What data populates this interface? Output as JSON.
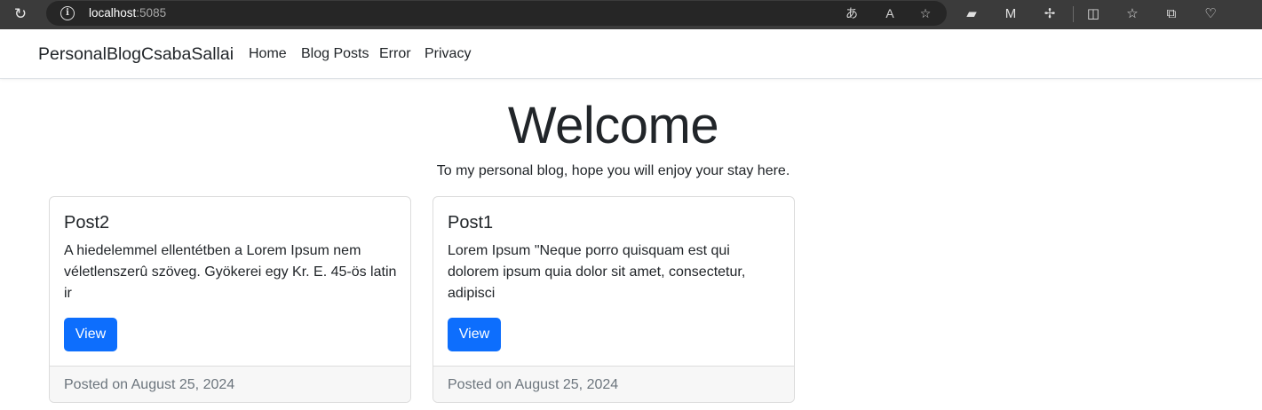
{
  "browser": {
    "url_host": "localhost",
    "url_port": ":5085",
    "icons": [
      "reload-icon",
      "info-icon",
      "read-aloud-icon",
      "text-size-icon",
      "favorite-star-icon",
      "extension-card-icon",
      "malwarebytes-icon",
      "extensions-puzzle-icon",
      "split-screen-icon",
      "favorites-icon",
      "collections-icon",
      "browser-essentials-icon"
    ]
  },
  "navbar": {
    "brand": "PersonalBlogCsabaSallai",
    "links": [
      "Home",
      "Blog Posts",
      "Error",
      "Privacy"
    ]
  },
  "hero": {
    "title": "Welcome",
    "subtitle": "To my personal blog, hope you will enjoy your stay here."
  },
  "posts": [
    {
      "title": "Post2",
      "excerpt": "A hiedelemmel ellentétben a Lorem Ipsum nem véletlenszerû szöveg. Gyökerei egy Kr. E. 45-ös latin ir",
      "button": "View",
      "footer": "Posted on August 25, 2024"
    },
    {
      "title": "Post1",
      "excerpt": "Lorem Ipsum \"Neque porro quisquam est qui dolorem ipsum quia dolor sit amet, consectetur, adipisci",
      "button": "View",
      "footer": "Posted on August 25, 2024"
    }
  ],
  "colors": {
    "primary": "#0d6efd",
    "chrome_bg": "#3b3b3b",
    "footer_text": "#6c757d"
  }
}
